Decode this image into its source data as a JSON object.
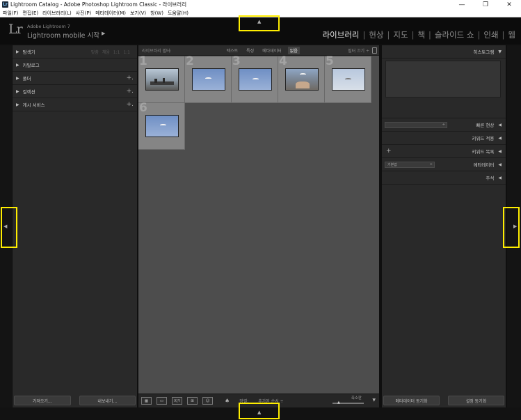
{
  "window": {
    "title": "Lightroom Catalog - Adobe Photoshop Lightroom Classic - 라이브러리",
    "app_icon": "Lr",
    "controls": [
      "—",
      "❐",
      "✕"
    ]
  },
  "menu": [
    "파일(F)",
    "편집(E)",
    "라이브러리(L)",
    "사진(P)",
    "메타데이터(M)",
    "보기(V)",
    "창(W)",
    "도움말(H)"
  ],
  "identity": {
    "logo": "Lr",
    "subtitle": "Adobe Lightroom 7",
    "mobile_label": "Lightroom mobile 시작",
    "arrow": "▶"
  },
  "modules": {
    "items": [
      "라이브러리",
      "현상",
      "지도",
      "책",
      "슬라이드 쇼",
      "인쇄",
      "웹"
    ],
    "active": "라이브러리",
    "separator": "|"
  },
  "left_panel": {
    "navigator": {
      "label": "탐색기",
      "options": "맞춤 채움 1:1 1:1"
    },
    "catalog": {
      "label": "카탈로그"
    },
    "folders": {
      "label": "폴더",
      "plus": "+."
    },
    "collections": {
      "label": "컬렉션",
      "plus": "+."
    },
    "publish": {
      "label": "게시 서비스",
      "plus": "+."
    },
    "import_button": "가져오기...",
    "export_button": "내보내기..."
  },
  "filter_bar": {
    "label": "라이브러리 필터:",
    "tabs": [
      "텍스트",
      "특성",
      "메타데이터",
      "없음"
    ],
    "selected": "없음",
    "right": "필터 끄기 ÷"
  },
  "grid": {
    "cells": [
      {
        "num": "1",
        "kind": "beach"
      },
      {
        "num": "2",
        "kind": "sky"
      },
      {
        "num": "3",
        "kind": "sky"
      },
      {
        "num": "4",
        "kind": "people"
      },
      {
        "num": "5",
        "kind": "pale"
      },
      {
        "num": "6",
        "kind": "sky"
      }
    ]
  },
  "toolbar": {
    "view_buttons": [
      "grid-view",
      "loupe-view",
      "compare-view",
      "survey-view",
      "people-view"
    ],
    "compare_text": "X|Y",
    "sort_label": "정렬:",
    "sort_value": "추가된 순서 ÷",
    "thumbnails_label": "축소판",
    "menu_arrow": "▼"
  },
  "right_panel": {
    "histogram": {
      "label": "히스토그램",
      "tri": "▼"
    },
    "quick_develop": {
      "label": "빠른 현상",
      "tri": "◀"
    },
    "keywording": {
      "label": "키워드 적용",
      "tri": "◀"
    },
    "keyword_list": {
      "label": "키워드 목록",
      "tri": "◀",
      "plus": "+"
    },
    "metadata": {
      "label": "메타데이터",
      "tri": "◀",
      "preset": "기본값",
      "preset_arrow": "÷"
    },
    "comments": {
      "label": "주석",
      "tri": "◀"
    },
    "sync_metadata_button": "메타데이터 동기화",
    "sync_settings_button": "설정 동기화"
  },
  "panel_toggles": {
    "top": "▲",
    "bottom": "▲",
    "left": "◀",
    "right": "▶"
  },
  "colors": {
    "highlight": "#ffee00",
    "background": "#0f0f0f",
    "panel": "#292929",
    "grid_bg": "#4d4d4d",
    "cell": "#858585"
  }
}
